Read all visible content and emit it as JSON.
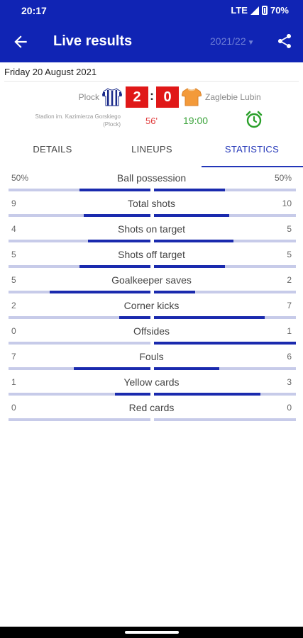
{
  "status_bar": {
    "time": "20:17",
    "network": "LTE",
    "battery": "70%"
  },
  "app_bar": {
    "title": "Live results",
    "season": "2021/22",
    "season_arrow": "▼"
  },
  "match": {
    "date": "Friday 20 August 2021",
    "home_team": "Plock",
    "away_team": "Zaglebie Lubin",
    "home_score": "2",
    "away_score": "0",
    "separator": ":",
    "stadium_line1": "Stadion im. Kazimierza Gorskiego",
    "stadium_line2": "(Plock)",
    "minute": "56'",
    "kickoff": "19:00",
    "home_colors": {
      "primary": "#1a2a8a",
      "secondary": "#ffffff"
    },
    "away_colors": {
      "primary": "#f39a3a",
      "secondary": "#f6c78c"
    }
  },
  "tabs": [
    {
      "label": "DETAILS",
      "active": false
    },
    {
      "label": "LINEUPS",
      "active": false
    },
    {
      "label": "STATISTICS",
      "active": true
    }
  ],
  "statistics": [
    {
      "name": "Ball possession",
      "home": "50%",
      "away": "50%",
      "home_share": 0.5,
      "away_share": 0.5
    },
    {
      "name": "Total shots",
      "home": "9",
      "away": "10",
      "home_share": 0.47,
      "away_share": 0.53
    },
    {
      "name": "Shots on target",
      "home": "4",
      "away": "5",
      "home_share": 0.44,
      "away_share": 0.56
    },
    {
      "name": "Shots off target",
      "home": "5",
      "away": "5",
      "home_share": 0.5,
      "away_share": 0.5
    },
    {
      "name": "Goalkeeper saves",
      "home": "5",
      "away": "2",
      "home_share": 0.71,
      "away_share": 0.29
    },
    {
      "name": "Corner kicks",
      "home": "2",
      "away": "7",
      "home_share": 0.22,
      "away_share": 0.78
    },
    {
      "name": "Offsides",
      "home": "0",
      "away": "1",
      "home_share": 0.0,
      "away_share": 1.0
    },
    {
      "name": "Fouls",
      "home": "7",
      "away": "6",
      "home_share": 0.54,
      "away_share": 0.46
    },
    {
      "name": "Yellow cards",
      "home": "1",
      "away": "3",
      "home_share": 0.25,
      "away_share": 0.75
    },
    {
      "name": "Red cards",
      "home": "0",
      "away": "0",
      "home_share": 0.0,
      "away_share": 0.0
    }
  ],
  "colors": {
    "primary": "#1024b4",
    "accent": "#2336b8",
    "bar_fill": "#1a2aae",
    "bar_track": "#c7cbe9",
    "score_bg": "#e01818",
    "live_minute": "#e03a3a",
    "kickoff": "#3aa33a"
  }
}
